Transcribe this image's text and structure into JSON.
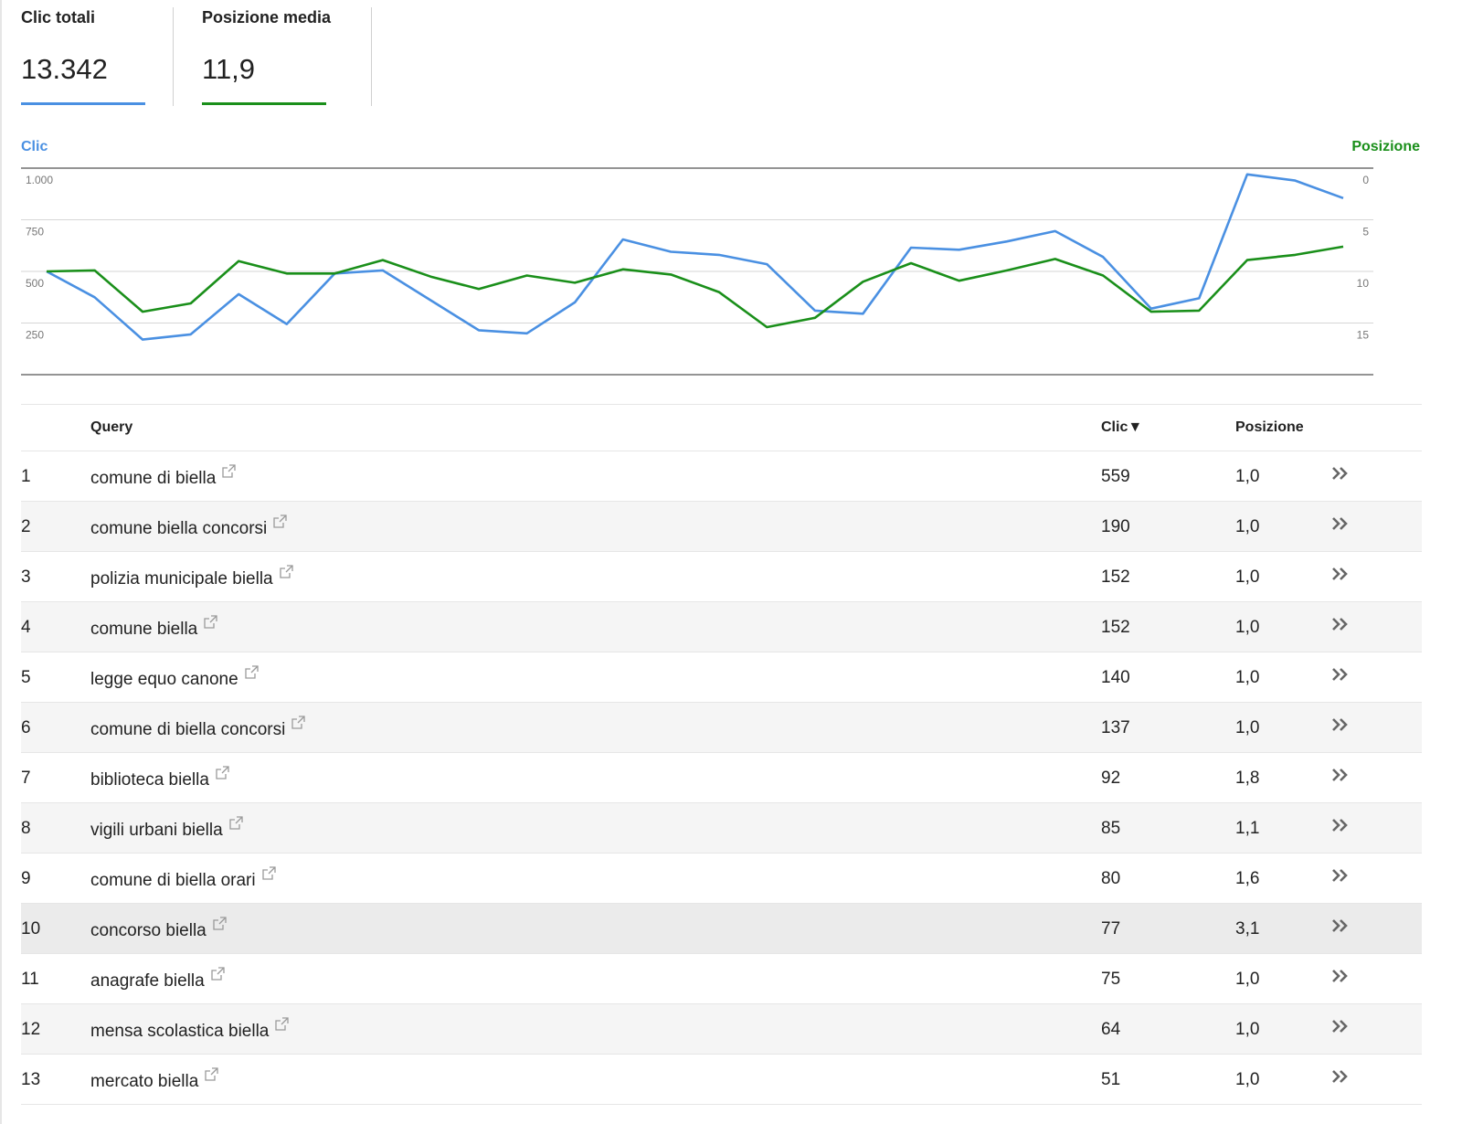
{
  "metrics": {
    "clicks": {
      "label": "Clic totali",
      "value": "13.342",
      "color": "#4a90e2"
    },
    "position": {
      "label": "Posizione media",
      "value": "11,9",
      "color": "#1a8f1a"
    }
  },
  "chart_data": {
    "type": "line",
    "left_axis": {
      "title": "Clic",
      "ticks": [
        "1.000",
        "750",
        "500",
        "250"
      ],
      "range": [
        0,
        1000
      ]
    },
    "right_axis": {
      "title": "Posizione",
      "ticks": [
        "0",
        "5",
        "10",
        "15"
      ],
      "range": [
        20,
        0
      ],
      "inverted": true
    },
    "grid": true,
    "series": [
      {
        "name": "Clic",
        "axis": "left",
        "color": "#4a90e2",
        "values": [
          500,
          375,
          170,
          195,
          390,
          245,
          490,
          505,
          360,
          215,
          200,
          350,
          655,
          595,
          580,
          535,
          310,
          295,
          615,
          605,
          645,
          695,
          570,
          320,
          370,
          970,
          940,
          855
        ]
      },
      {
        "name": "Posizione",
        "axis": "right",
        "color": "#1a8f1a",
        "values": [
          10.0,
          9.9,
          13.9,
          13.1,
          9.0,
          10.2,
          10.2,
          8.9,
          10.5,
          11.7,
          10.4,
          11.1,
          9.8,
          10.3,
          12.0,
          15.4,
          14.5,
          11.0,
          9.2,
          10.9,
          9.9,
          8.8,
          10.4,
          13.9,
          13.8,
          8.9,
          8.4,
          7.6
        ]
      }
    ]
  },
  "table": {
    "headers": {
      "query": "Query",
      "clicks": "Clic▼",
      "position": "Posizione"
    },
    "rows": [
      {
        "n": "1",
        "query": "comune di biella",
        "clicks": "559",
        "position": "1,0"
      },
      {
        "n": "2",
        "query": "comune biella concorsi",
        "clicks": "190",
        "position": "1,0"
      },
      {
        "n": "3",
        "query": "polizia municipale biella",
        "clicks": "152",
        "position": "1,0"
      },
      {
        "n": "4",
        "query": "comune biella",
        "clicks": "152",
        "position": "1,0"
      },
      {
        "n": "5",
        "query": "legge equo canone",
        "clicks": "140",
        "position": "1,0"
      },
      {
        "n": "6",
        "query": "comune di biella concorsi",
        "clicks": "137",
        "position": "1,0"
      },
      {
        "n": "7",
        "query": "biblioteca biella",
        "clicks": "92",
        "position": "1,8"
      },
      {
        "n": "8",
        "query": "vigili urbani biella",
        "clicks": "85",
        "position": "1,1"
      },
      {
        "n": "9",
        "query": "comune di biella orari",
        "clicks": "80",
        "position": "1,6"
      },
      {
        "n": "10",
        "query": "concorso biella",
        "clicks": "77",
        "position": "3,1"
      },
      {
        "n": "11",
        "query": "anagrafe biella",
        "clicks": "75",
        "position": "1,0"
      },
      {
        "n": "12",
        "query": "mensa scolastica biella",
        "clicks": "64",
        "position": "1,0"
      },
      {
        "n": "13",
        "query": "mercato biella",
        "clicks": "51",
        "position": "1,0"
      }
    ],
    "highlighted_row": 10
  }
}
